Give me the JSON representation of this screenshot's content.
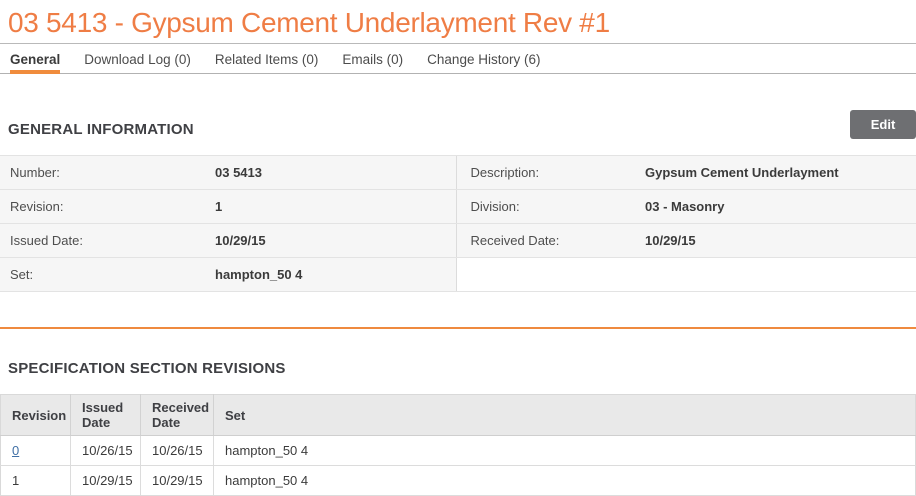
{
  "page": {
    "title": "03 5413 - Gypsum Cement Underlayment Rev #1"
  },
  "tabs": [
    {
      "label": "General",
      "active": true
    },
    {
      "label": "Download Log (0)",
      "active": false
    },
    {
      "label": "Related Items (0)",
      "active": false
    },
    {
      "label": "Emails (0)",
      "active": false
    },
    {
      "label": "Change History (6)",
      "active": false
    }
  ],
  "general_information": {
    "heading": "GENERAL INFORMATION",
    "edit_button_label": "Edit",
    "fields_left": [
      {
        "label": "Number:",
        "value": "03 5413"
      },
      {
        "label": "Revision:",
        "value": "1"
      },
      {
        "label": "Issued Date:",
        "value": "10/29/15"
      },
      {
        "label": "Set:",
        "value": "hampton_50 4"
      }
    ],
    "fields_right": [
      {
        "label": "Description:",
        "value": "Gypsum Cement Underlayment"
      },
      {
        "label": "Division:",
        "value": "03 - Masonry"
      },
      {
        "label": "Received Date:",
        "value": "10/29/15"
      },
      {
        "label": "",
        "value": ""
      }
    ]
  },
  "revisions": {
    "heading": "SPECIFICATION SECTION REVISIONS",
    "columns": [
      "Revision",
      "Issued Date",
      "Received Date",
      "Set"
    ],
    "rows": [
      {
        "revision": "0",
        "revision_is_link": true,
        "issued_date": "10/26/15",
        "received_date": "10/26/15",
        "set": "hampton_50 4"
      },
      {
        "revision": "1",
        "revision_is_link": false,
        "issued_date": "10/29/15",
        "received_date": "10/29/15",
        "set": "hampton_50 4"
      }
    ]
  },
  "colors": {
    "accent_orange": "#ef7d45",
    "tab_underline_orange": "#f08c3d",
    "divider_orange": "#ef8a3f",
    "edit_button_gray": "#6e6f72",
    "link_blue": "#3f6fa5",
    "table_header_gray": "#e9e9e9",
    "field_row_gray": "#f6f6f6"
  }
}
